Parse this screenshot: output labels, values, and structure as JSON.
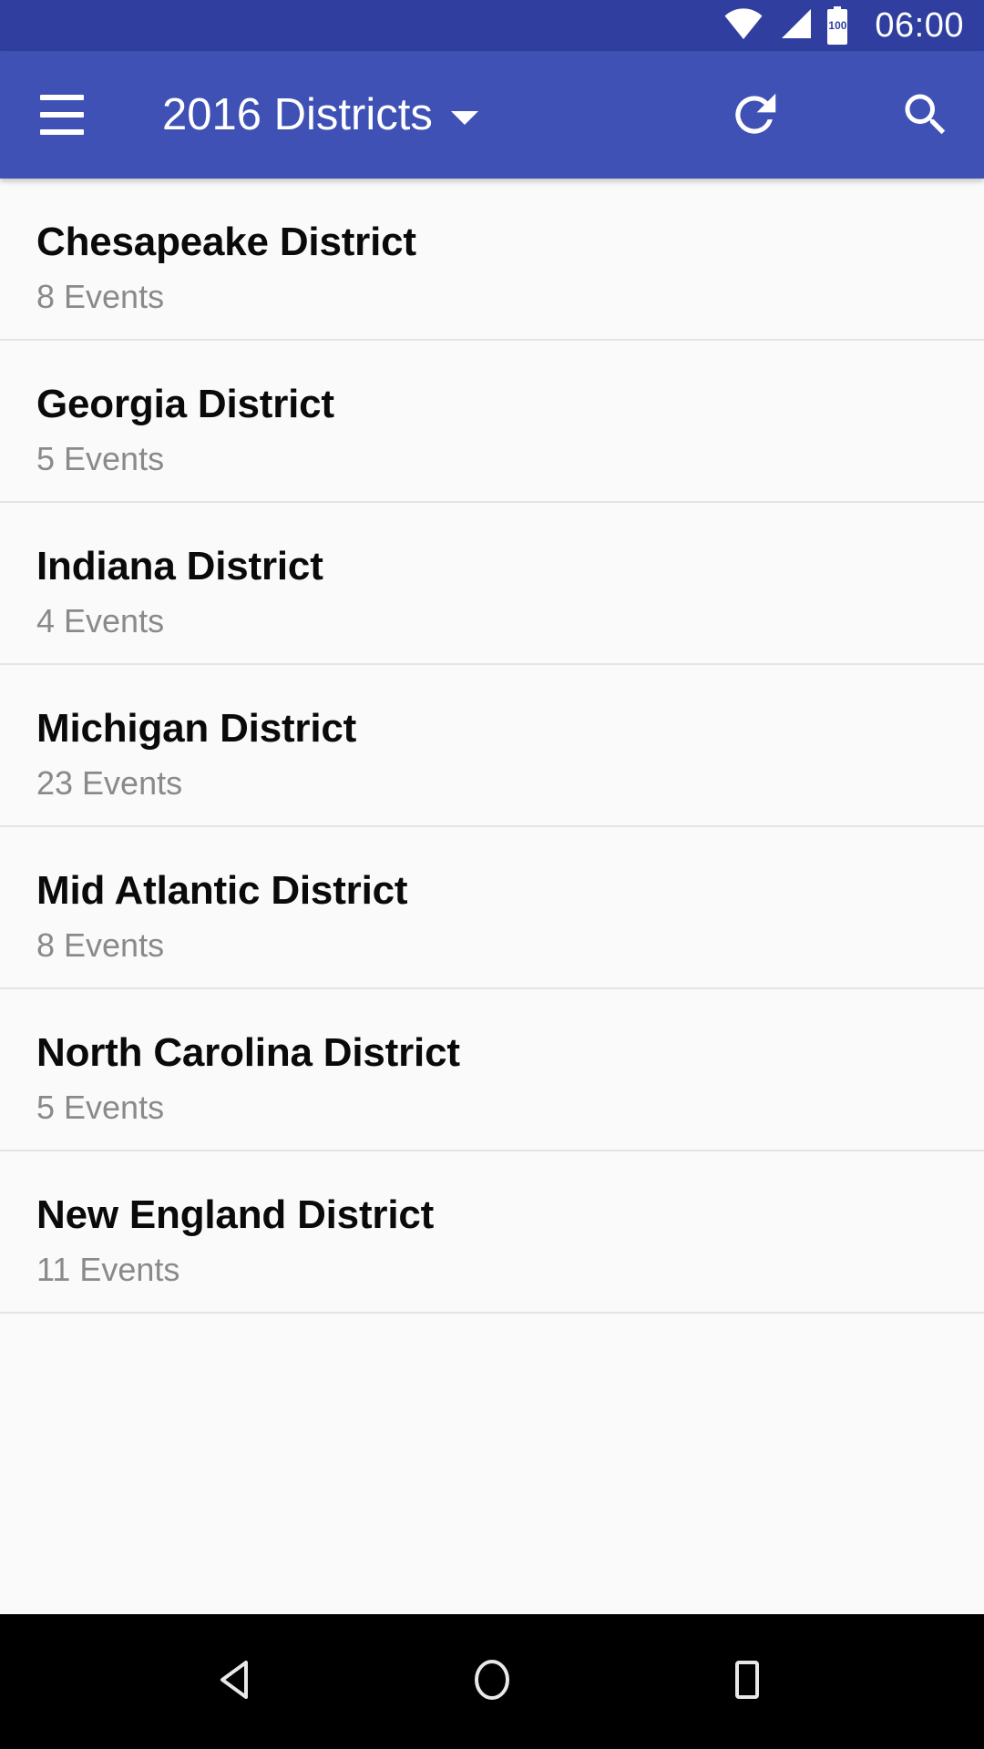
{
  "status_bar": {
    "wifi_icon": "wifi-icon",
    "signal_icon": "cell-signal-icon",
    "battery_icon": "battery-icon",
    "battery_level": "100",
    "time": "06:00",
    "background_color": "#303f9f"
  },
  "toolbar": {
    "menu_icon": "hamburger-menu-icon",
    "title": "2016 Districts",
    "dropdown_icon": "caret-down-icon",
    "refresh_icon": "refresh-icon",
    "search_icon": "search-icon",
    "background_color": "#3f51b5",
    "text_color": "#ffffff"
  },
  "list": {
    "items": [
      {
        "title": "Chesapeake District",
        "subtitle": "8 Events"
      },
      {
        "title": "Georgia District",
        "subtitle": "5 Events"
      },
      {
        "title": "Indiana District",
        "subtitle": "4 Events"
      },
      {
        "title": "Michigan District",
        "subtitle": "23 Events"
      },
      {
        "title": "Mid Atlantic District",
        "subtitle": "8 Events"
      },
      {
        "title": "North Carolina District",
        "subtitle": "5 Events"
      },
      {
        "title": "New England District",
        "subtitle": "11 Events"
      }
    ],
    "background_color": "#fafafa",
    "divider_color": "#e4e4e4",
    "title_color": "#0a0a0a",
    "subtitle_color": "#8a8a8a"
  },
  "nav_bar": {
    "back_icon": "back-triangle-icon",
    "home_icon": "home-circle-icon",
    "recents_icon": "recents-square-icon",
    "background_color": "#000000"
  }
}
